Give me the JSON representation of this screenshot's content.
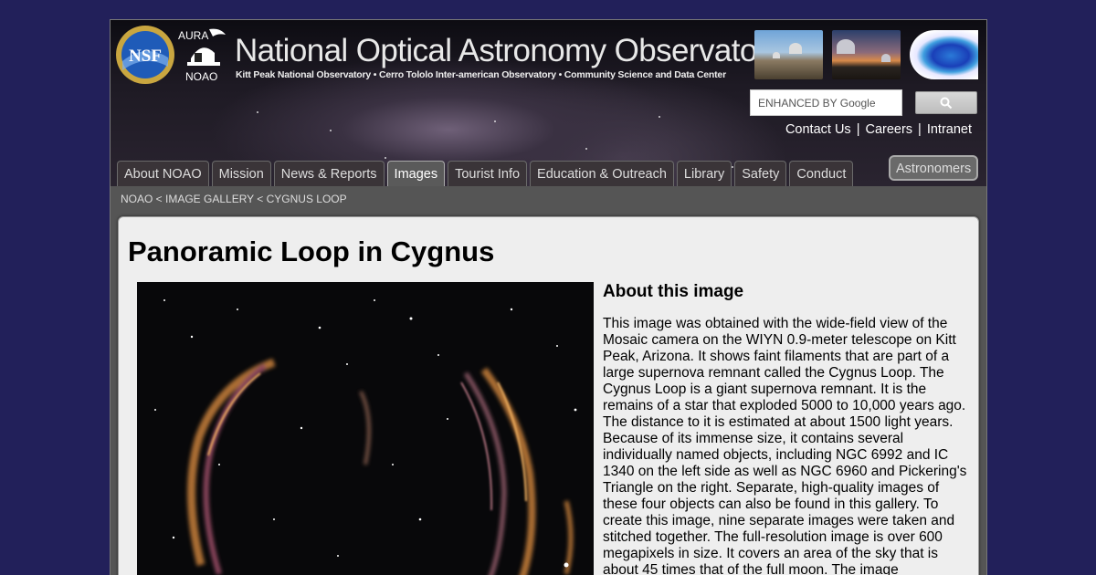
{
  "header": {
    "nsf_logo_text": "NSF",
    "aura_logo_text": "AURA",
    "noao_logo_text": "NOAO",
    "title": "National Optical Astronomy Observatory",
    "subtitle": "Kitt Peak National Observatory • Cerro Tololo Inter-american Observatory • Community Science and Data Center"
  },
  "search": {
    "placeholder": "ENHANCED BY Google",
    "button_icon": "search-icon"
  },
  "top_links": [
    "Contact Us",
    "Careers",
    "Intranet"
  ],
  "nav": {
    "tabs": [
      "About NOAO",
      "Mission",
      "News & Reports",
      "Images",
      "Tourist Info",
      "Education & Outreach",
      "Library",
      "Safety",
      "Conduct"
    ],
    "active": "Images",
    "astronomers": "Astronomers"
  },
  "breadcrumb": "NOAO < IMAGE GALLERY < CYGNUS LOOP",
  "page_title": "Panoramic Loop in Cygnus",
  "about": {
    "heading": "About this image",
    "text": "This image was obtained with the wide-field view of the Mosaic camera on the WIYN 0.9-meter telescope on Kitt Peak, Arizona. It shows faint filaments that are part of a large supernova remnant called the Cygnus Loop. The Cygnus Loop is a giant supernova remnant. It is the remains of a star that exploded 5000 to 10,000 years ago. The distance to it is estimated at about 1500 light years. Because of its immense size, it contains several individually named objects, including NGC 6992 and IC 1340 on the left side as well as NGC 6960 and Pickering's Triangle on the right. Separate, high-quality images of these four objects can also be found in this gallery. To create this image, nine separate images were taken and stitched together. The full-resolution image is over 600 megapixels in size. It covers an area of the sky that is about 45 times that of the full moon. The image"
  },
  "colors": {
    "background": "#22205a",
    "content_panel": "#eeeeee",
    "header_dark": "#1e1a24"
  }
}
